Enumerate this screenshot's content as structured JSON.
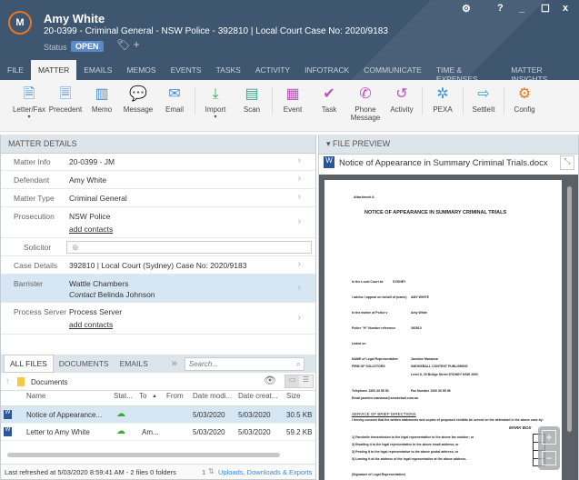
{
  "header": {
    "logo": "M",
    "name": "Amy White",
    "subtitle": "20-0399 - Criminal General - NSW Police - 392810 | Local Court Case No: 2020/9183",
    "status_label": "Status",
    "status": "OPEN"
  },
  "window": {
    "settings": "⚙",
    "help": "?",
    "minimize": "_",
    "maximize": "☐",
    "close": "x"
  },
  "tabs": [
    "FILE",
    "MATTER",
    "EMAILS",
    "MEMOS",
    "EVENTS",
    "TASKS",
    "ACTIVITY",
    "INFOTRACK",
    "COMMUNICATE",
    "TIME & EXPENSES",
    "MATTER INSIGHTS"
  ],
  "ribbon": [
    {
      "label": "Letter/Fax",
      "icon": "🗎",
      "color": "#4a90d9"
    },
    {
      "label": "Precedent",
      "icon": "🗏",
      "color": "#4a90d9"
    },
    {
      "label": "Memo",
      "icon": "▥",
      "color": "#4a90d9"
    },
    {
      "label": "Message",
      "icon": "💬",
      "color": "#4a90d9"
    },
    {
      "label": "Email",
      "icon": "✉",
      "color": "#4a90d9"
    },
    {
      "label": "Import",
      "icon": "⤓",
      "color": "#3aaa5a"
    },
    {
      "label": "Scan",
      "icon": "▤",
      "color": "#3aaa8a"
    },
    {
      "label": "Event",
      "icon": "▦",
      "color": "#c050c0"
    },
    {
      "label": "Task",
      "icon": "✔",
      "color": "#c050c0"
    },
    {
      "label": "Phone Message",
      "icon": "✆",
      "color": "#c050c0"
    },
    {
      "label": "Activity",
      "icon": "↺",
      "color": "#c050c0"
    },
    {
      "label": "PEXA",
      "icon": "✲",
      "color": "#3a9ad9"
    },
    {
      "label": "SettleIt",
      "icon": "⇨",
      "color": "#3a9ad9"
    },
    {
      "label": "Config",
      "icon": "⚙",
      "color": "#e87722"
    }
  ],
  "matter_details": {
    "title": "MATTER DETAILS",
    "rows": [
      {
        "label": "Matter Info",
        "value": "20-0399 - JM"
      },
      {
        "label": "Defendant",
        "value": "Amy White"
      },
      {
        "label": "Matter Type",
        "value": "Criminal General"
      },
      {
        "label": "Prosecution",
        "value": "NSW Police",
        "link": "add contacts"
      },
      {
        "label": "Solicitor"
      },
      {
        "label": "Case Details",
        "value": "392810 | Local Court (Sydney) Case No: 2020/9183"
      },
      {
        "label": "Barrister",
        "value": "Wattle Chambers",
        "contact_label": "Contact",
        "contact": "Belinda Johnson"
      },
      {
        "label": "Process Server",
        "value": "Process Server",
        "link": "add contacts"
      }
    ]
  },
  "files": {
    "tabs": [
      "ALL FILES",
      "DOCUMENTS",
      "EMAILS"
    ],
    "search_placeholder": "Search...",
    "folder": "Documents",
    "columns": [
      "Name",
      "Stat...",
      "To",
      "From",
      "Date modi...",
      "Date creat...",
      "Size"
    ],
    "rows": [
      {
        "name": "Notice of Appearance...",
        "to": "",
        "from": "",
        "modified": "5/03/2020",
        "created": "5/03/2020",
        "size": "30.5 KB"
      },
      {
        "name": "Letter to Amy White",
        "to": "Am...",
        "from": "",
        "modified": "5/03/2020",
        "created": "5/03/2020",
        "size": "59.2 KB"
      }
    ],
    "status": "Last refreshed at 5/03/2020 8:59:41 AM  -  2 files 0 folders",
    "transfers_count": "1",
    "transfers_link": "Uploads, Downloads & Exports"
  },
  "preview": {
    "title": "FILE PREVIEW",
    "filename": "Notice of Appearance in Summary Criminal Trials.docx",
    "doc": {
      "attachment": "Attachment A",
      "heading": "NOTICE OF APPEARANCE IN SUMMARY CRIMINAL TRIALS",
      "fields": [
        [
          "In the Local Court at:",
          "SYDNEY"
        ],
        [
          "I advise I appear on behalf of (name)",
          "AMY WHITE"
        ],
        [
          "In the matter of Police v",
          "Amy White"
        ],
        [
          "Police \"H\" Number reference",
          "392810"
        ],
        [
          "Listed on",
          ""
        ],
        [
          "NAME of Legal Representative",
          "Jasmine Manassa"
        ],
        [
          "FIRM OF SOLICITORS",
          "SMOKEBALL CONTENT PUBLISHING"
        ]
      ],
      "address": "Level 8, 20 Bridge Street SYDNEY NSW 2000",
      "telephone": "Telephone   1300 33 55 53",
      "fax": "Fax Number   1300 33 55 99",
      "email": "Email jasmine.manassa@smokeball.com.au",
      "service_heading": "SERVICE OF BRIEF DIRECTIONS",
      "service_text": "I hereby consent that the written statements and copies of proposed exhibits be served on the defendant in the above case by:",
      "mark_box": "MARK BOX",
      "options": [
        "1) Facsimile transmission to the legal representative to the above fax number; or",
        "2) Emailing it to the legal representative to the above email address; or",
        "2) Posting it to the legal representative to the above postal address; or",
        "3) Leaving it at the address of the legal representative at the above address."
      ],
      "signature": "(Signature of Legal Representative)"
    }
  }
}
